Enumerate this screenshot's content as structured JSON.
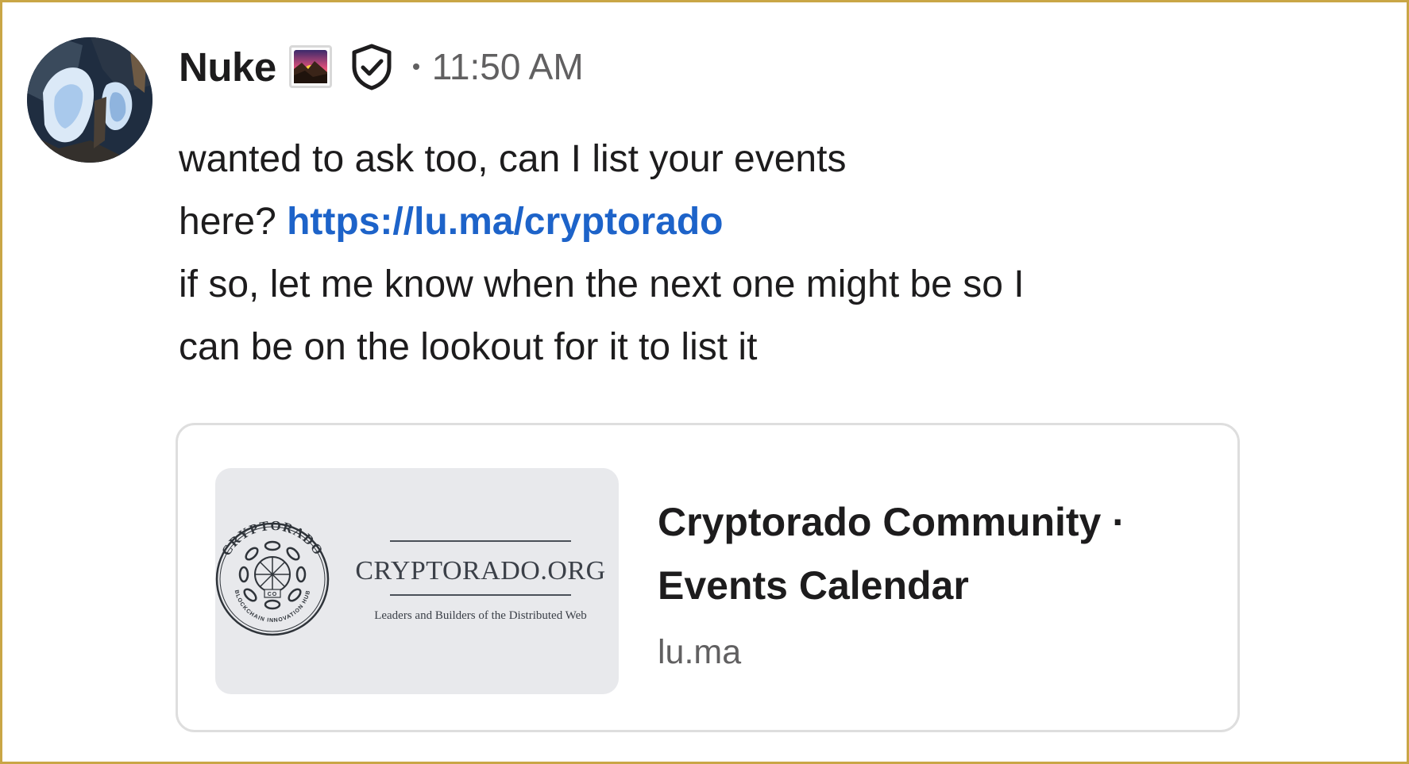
{
  "message": {
    "sender_name": "Nuke",
    "timestamp": "11:50 AM",
    "badge_icon": "sunrise-emoji",
    "verified_icon": "shield-check-icon",
    "lines": {
      "line1": "wanted to ask too, can I list your events",
      "line2_prefix": "here?",
      "link": "https://lu.ma/cryptorado",
      "line3": "if so, let me know when the next one might be so I",
      "line4": "can be on the lookout for it to list it"
    }
  },
  "link_preview": {
    "title_line1": "Cryptorado Community ·",
    "title_line2": "Events Calendar",
    "domain": "lu.ma",
    "thumbnail": {
      "org_name": "CRYPTORADO.ORG",
      "tagline": "Leaders and Builders of the Distributed Web",
      "seal_top": "CRYPTORADO",
      "seal_bottom": "BLOCKCHAIN INNOVATION HUB",
      "seal_center": "CO"
    }
  },
  "colors": {
    "frame_border": "#c9a646",
    "link": "#1d63c9",
    "text": "#1d1c1d",
    "muted": "#616061"
  }
}
